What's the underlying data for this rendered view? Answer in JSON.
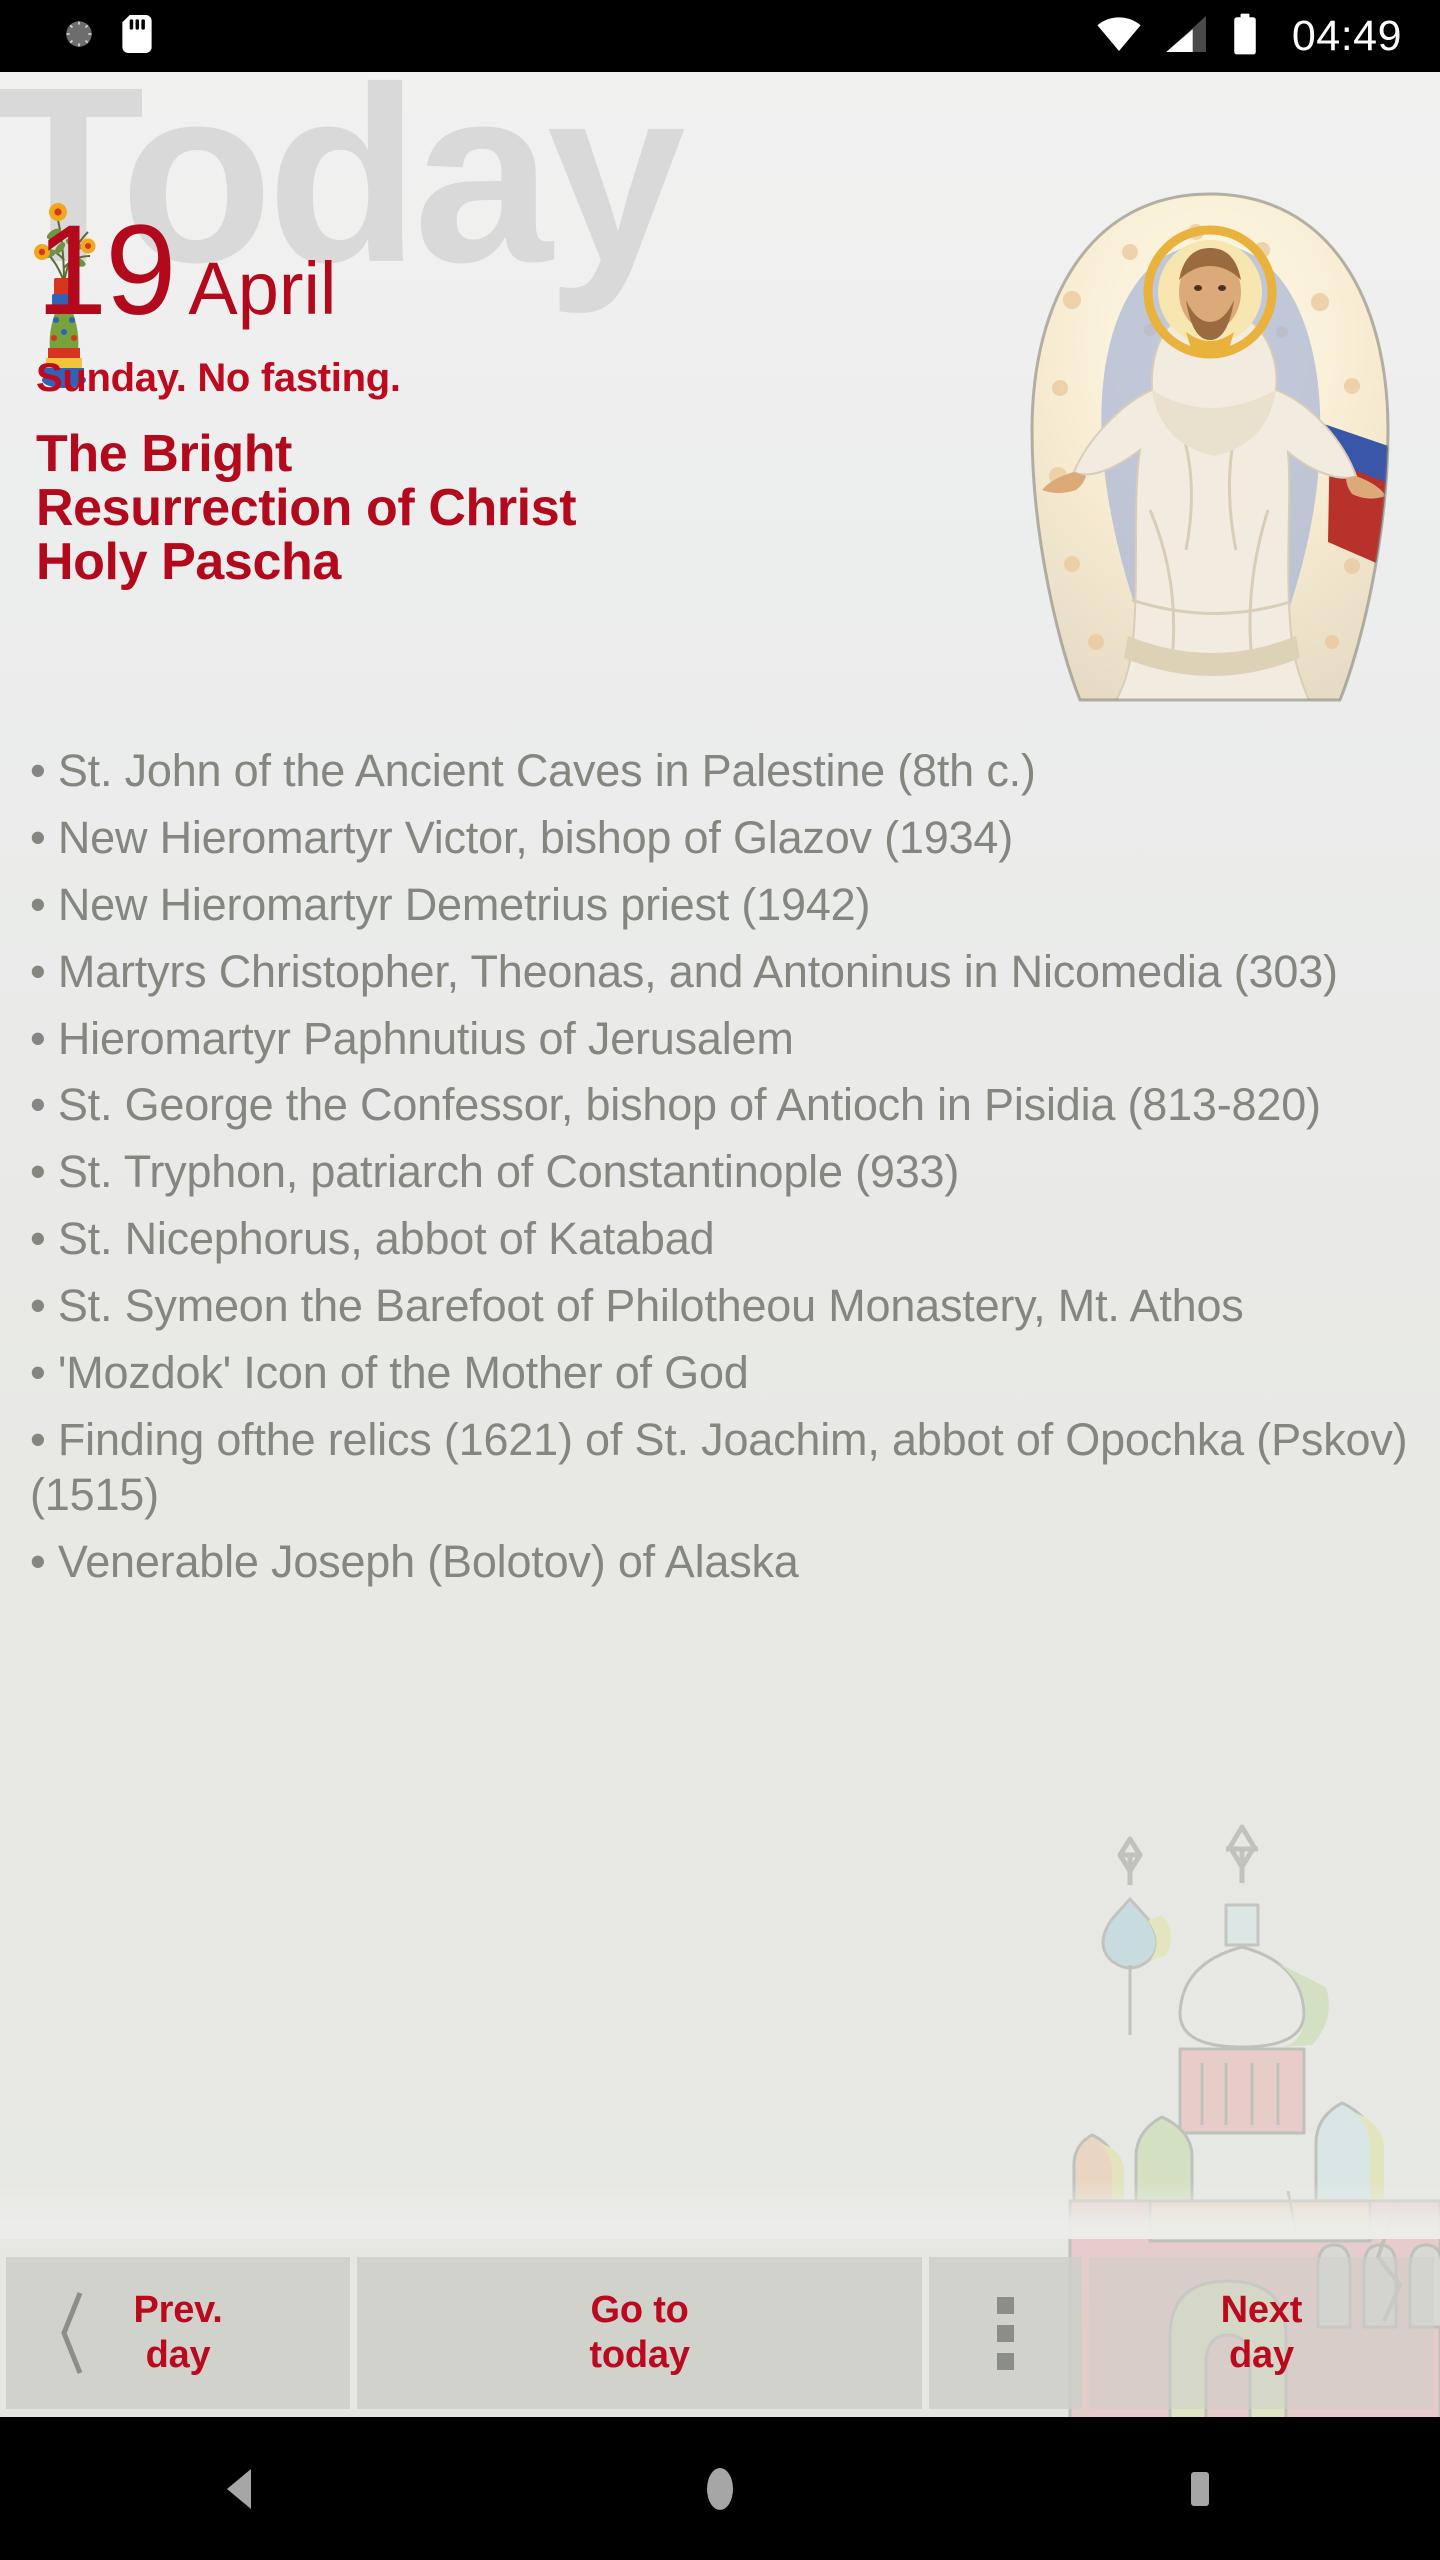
{
  "statusbar": {
    "time": "04:49",
    "left_icons": [
      "alarm-clock-icon",
      "sd-card-icon"
    ],
    "right_icons": [
      "wifi-icon",
      "cellular-signal-icon",
      "battery-icon"
    ]
  },
  "header": {
    "watermark_word": "Today",
    "day": "19",
    "month": "April",
    "subtitle": "Sunday. No fasting.",
    "feast_title_lines": [
      "The Bright",
      "Resurrection of Christ",
      "Holy Pascha"
    ],
    "decoration_icon": "pascha-vase-icon",
    "feast_image": "resurrection-of-christ-icon"
  },
  "saints": [
    "• St. John of the Ancient Caves in Palestine (8th c.)",
    "• New Hieromartyr Victor, bishop of Glazov (1934)",
    "• New Hieromartyr Demetrius priest (1942)",
    "• Martyrs Christopher, Theonas, and Antoninus in Nicomedia (303)",
    "• Hieromartyr Paphnutius of Jerusalem",
    "• St. George the Confessor, bishop of Antioch in Pisidia (813-820)",
    "• St. Tryphon, patriarch of Constantinople (933)",
    "• St. Nicephorus, abbot of Katabad",
    "• St. Symeon the Barefoot of Philotheou Monastery, Mt. Athos",
    "• 'Mozdok' Icon of the Mother of God",
    "• Finding ofthe relics (1621) of St. Joachim, abbot of Opochka (Pskov) (1515)",
    "• Venerable Joseph (Bolotov) of Alaska"
  ],
  "buttons": {
    "prev_day_line1": "Prev.",
    "prev_day_line2": "day",
    "go_to_today_line1": "Go to",
    "go_to_today_line2": "today",
    "next_day_line1": "Next",
    "next_day_line2": "day",
    "overflow_icon": "kebab-menu-icon",
    "prev_icon": "chevron-left-icon"
  },
  "navbar": {
    "back_icon": "back-triangle-icon",
    "home_icon": "home-circle-icon",
    "recents_icon": "recents-square-icon"
  },
  "colors": {
    "accent_red": "#b3091d",
    "subtitle_red": "#be0a1e",
    "body_gray": "#848780",
    "watermark_gray": "#d9d9d9",
    "app_background": "#ecedea",
    "button_background": "#cecece"
  }
}
